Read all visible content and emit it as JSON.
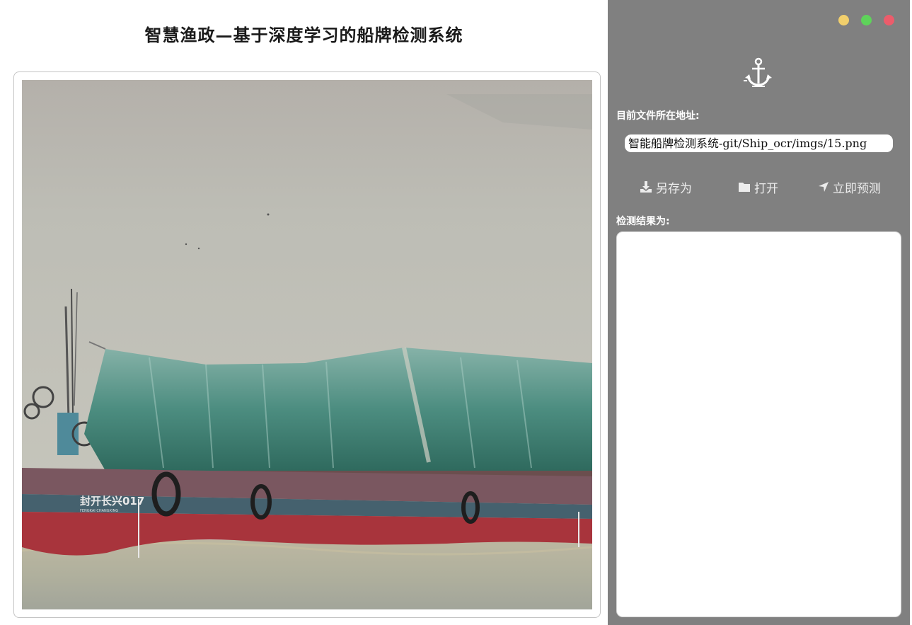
{
  "app": {
    "title": "智慧渔政—基于深度学习的船牌检测系统"
  },
  "preview": {
    "image_subject": "cargo barge with green tarpaulin cover on river",
    "hull_text": "封开长兴017",
    "hull_subtext": "FENGKAI CHANGXING"
  },
  "panel": {
    "logo_icon": "anchor-icon",
    "window_controls": [
      {
        "name": "minimize",
        "color": "#f1cf6c"
      },
      {
        "name": "maximize",
        "color": "#5ed35a"
      },
      {
        "name": "close",
        "color": "#ec5c6b"
      }
    ],
    "path_label": "目前文件所在地址:",
    "path_value": "智能船牌检测系统-git/Ship_ocr/imgs/15.png",
    "buttons": {
      "save": {
        "label": "另存为",
        "icon": "download-icon"
      },
      "open": {
        "label": "打开",
        "icon": "folder-icon"
      },
      "predict": {
        "label": "立即预测",
        "icon": "location-arrow-icon"
      }
    },
    "result_label": "检测结果为:",
    "result_text": ""
  },
  "colors": {
    "panel_bg": "#808080",
    "panel_text": "#ffffff"
  }
}
